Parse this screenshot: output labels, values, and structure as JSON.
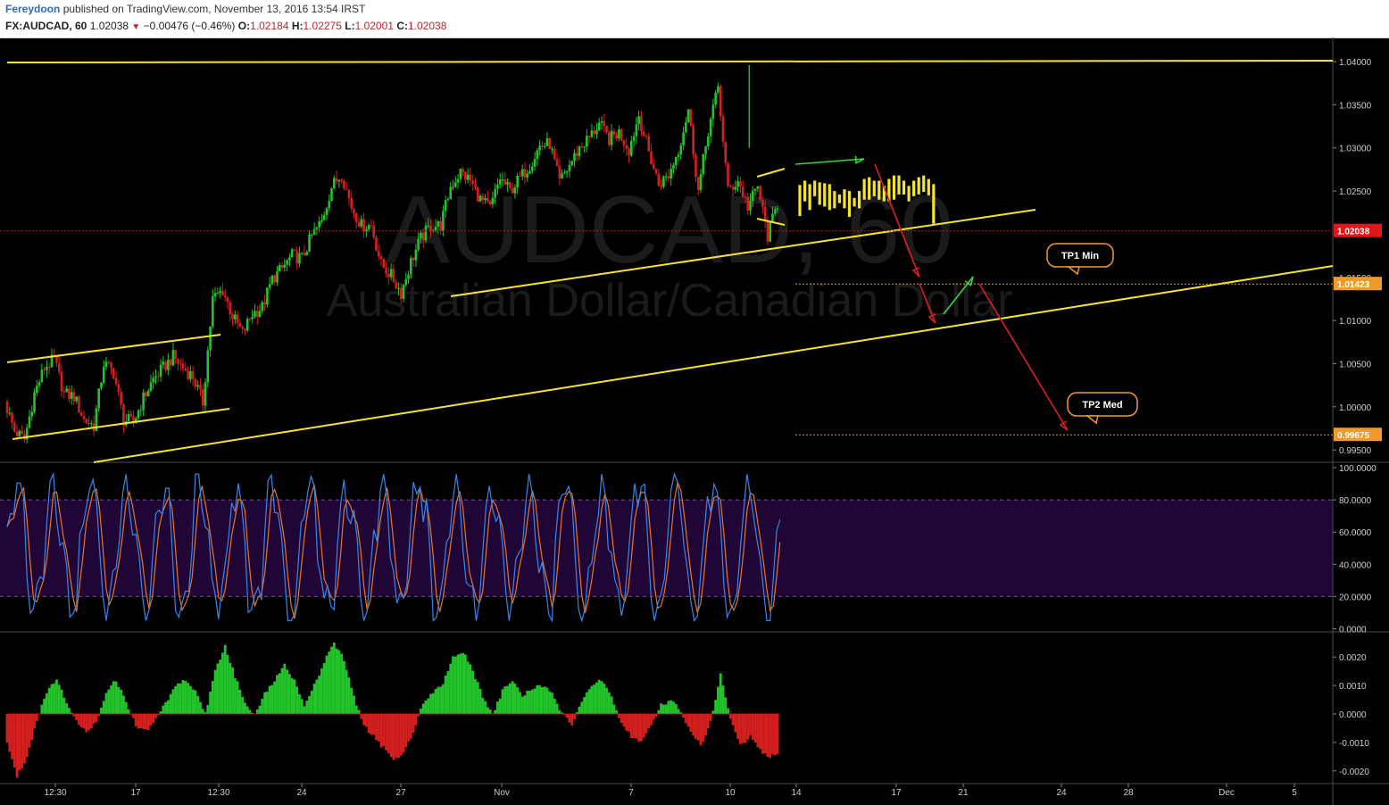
{
  "header": {
    "author": "Fereydoon",
    "published": "published on TradingView.com, November 13, 2016 13:54 IRST",
    "symbol": "FX:AUDCAD, 60",
    "last": "1.02038",
    "change": "−0.00476 (−0.46%)",
    "o_label": "O:",
    "o_value": "1.02184",
    "h_label": "H:",
    "h_value": "1.02275",
    "l_label": "L:",
    "l_value": "1.02001",
    "c_label": "C:",
    "c_value": "1.02038"
  },
  "colors": {
    "background": "#000000",
    "bull": "#22c42a",
    "bear": "#d41f1f",
    "trendline": "#f5e52a",
    "projection": "#f5e52a",
    "arrow_up": "#2fdc2f",
    "arrow_down": "#dd2020",
    "stoch_k": "#3a86e8",
    "stoch_d": "#e8742a",
    "stoch_band": "#1f0636",
    "label_orange": "#f09a2a",
    "price_red": "#e01818"
  },
  "watermark": {
    "symbol": "AUDCAD, 60",
    "name": "Australian Dollar/Canadian Dollar"
  },
  "chart_data": [
    {
      "type": "candlestick",
      "title": "FX:AUDCAD, 60",
      "x_ticks": [
        "12:30",
        "17",
        "12:30",
        "24",
        "27",
        "Nov",
        "7",
        "10",
        "14",
        "17",
        "21",
        "24",
        "28",
        "Dec",
        "5"
      ],
      "y_ticks": [
        "1.04000",
        "1.03500",
        "1.03000",
        "1.02500",
        "1.01500",
        "1.01000",
        "1.00500",
        "1.00000",
        "0.99500"
      ],
      "ylim": [
        0.9935,
        1.0416
      ],
      "close_path": [
        [
          0,
          1.0006
        ],
        [
          1,
          0.9972
        ],
        [
          2,
          0.9962
        ],
        [
          3,
          1.0015
        ],
        [
          4,
          1.0045
        ],
        [
          5,
          1.0055
        ],
        [
          6,
          1.0015
        ],
        [
          7,
          1.0012
        ],
        [
          8,
          0.9985
        ],
        [
          9,
          0.9978
        ],
        [
          10,
          1.005
        ],
        [
          11,
          1.004
        ],
        [
          12,
          0.9985
        ],
        [
          13,
          0.9982
        ],
        [
          14,
          1.001
        ],
        [
          15,
          1.0032
        ],
        [
          16,
          1.0045
        ],
        [
          17,
          1.0058
        ],
        [
          18,
          1.0045
        ],
        [
          19,
          1.0035
        ],
        [
          20,
          1.0005
        ],
        [
          21,
          1.0125
        ],
        [
          22,
          1.0135
        ],
        [
          23,
          1.0105
        ],
        [
          24,
          1.0085
        ],
        [
          25,
          1.0108
        ],
        [
          26,
          1.0115
        ],
        [
          27,
          1.0148
        ],
        [
          28,
          1.016
        ],
        [
          29,
          1.0175
        ],
        [
          30,
          1.0172
        ],
        [
          31,
          1.0198
        ],
        [
          32,
          1.0215
        ],
        [
          33,
          1.0255
        ],
        [
          34,
          1.027
        ],
        [
          35,
          1.0232
        ],
        [
          36,
          1.021
        ],
        [
          37,
          1.021
        ],
        [
          38,
          1.0165
        ],
        [
          39,
          1.0152
        ],
        [
          40,
          1.0132
        ],
        [
          41,
          1.0168
        ],
        [
          42,
          1.0195
        ],
        [
          43,
          1.021
        ],
        [
          44,
          1.021
        ],
        [
          45,
          1.0255
        ],
        [
          46,
          1.0272
        ],
        [
          47,
          1.0262
        ],
        [
          48,
          1.024
        ],
        [
          49,
          1.023
        ],
        [
          50,
          1.0265
        ],
        [
          51,
          1.025
        ],
        [
          52,
          1.0265
        ],
        [
          53,
          1.028
        ],
        [
          54,
          1.0302
        ],
        [
          55,
          1.0305
        ],
        [
          56,
          1.026
        ],
        [
          57,
          1.028
        ],
        [
          58,
          1.03
        ],
        [
          59,
          1.0312
        ],
        [
          60,
          1.0328
        ],
        [
          61,
          1.031
        ],
        [
          62,
          1.0318
        ],
        [
          63,
          1.0298
        ],
        [
          64,
          1.0338
        ],
        [
          65,
          1.0295
        ],
        [
          66,
          1.0258
        ],
        [
          67,
          1.0268
        ],
        [
          68,
          1.0298
        ],
        [
          69,
          1.0345
        ],
        [
          70,
          1.025
        ],
        [
          71,
          1.032
        ],
        [
          72,
          1.037
        ],
        [
          73,
          1.025
        ],
        [
          74,
          1.0262
        ],
        [
          75,
          1.0232
        ],
        [
          76,
          1.0255
        ],
        [
          77,
          1.0198
        ],
        [
          78,
          1.0236
        ]
      ],
      "last_price": 1.02038,
      "price_line_label": "1.02038",
      "levels": [
        {
          "value": 1.01423,
          "label": "1.01423",
          "note": "TP1 Min"
        },
        {
          "value": 0.99675,
          "label": "0.99675",
          "note": "TP2 Med"
        }
      ],
      "annotations": [
        "TP1 Min",
        "TP2 Med"
      ],
      "grid": false
    },
    {
      "type": "line",
      "title": "",
      "y_ticks": [
        "100.0000",
        "80.0000",
        "60.0000",
        "40.0000",
        "20.0000",
        "0.0000"
      ],
      "ylim": [
        0,
        100
      ],
      "band": [
        20,
        80
      ],
      "series": [
        {
          "values": []
        },
        {
          "values": []
        }
      ]
    },
    {
      "type": "bar",
      "title": "",
      "y_ticks": [
        "0.0020",
        "0.0010",
        "0.0000",
        "-0.0010",
        "-0.0020"
      ],
      "ylim": [
        -0.0023,
        0.0026
      ],
      "values": [
        [
          0,
          -0.001
        ],
        [
          1,
          -0.0022
        ],
        [
          2,
          -0.0015
        ],
        [
          3,
          -0.0002
        ],
        [
          4,
          0.0008
        ],
        [
          5,
          0.0012
        ],
        [
          6,
          0.0004
        ],
        [
          7,
          -0.0002
        ],
        [
          8,
          -0.0007
        ],
        [
          9,
          -0.0003
        ],
        [
          10,
          0.0008
        ],
        [
          11,
          0.0012
        ],
        [
          12,
          0.0004
        ],
        [
          13,
          -0.0004
        ],
        [
          14,
          -0.0006
        ],
        [
          15,
          -0.0002
        ],
        [
          16,
          0.0004
        ],
        [
          17,
          0.001
        ],
        [
          18,
          0.0012
        ],
        [
          19,
          0.0008
        ],
        [
          20,
          0.0
        ],
        [
          21,
          0.0015
        ],
        [
          22,
          0.0024
        ],
        [
          23,
          0.0013
        ],
        [
          24,
          0.0004
        ],
        [
          25,
          0.0
        ],
        [
          26,
          0.0007
        ],
        [
          27,
          0.0012
        ],
        [
          28,
          0.0017
        ],
        [
          29,
          0.0012
        ],
        [
          30,
          0.0003
        ],
        [
          31,
          0.001
        ],
        [
          32,
          0.0018
        ],
        [
          33,
          0.0025
        ],
        [
          34,
          0.0019
        ],
        [
          35,
          0.0006
        ],
        [
          36,
          -0.0004
        ],
        [
          37,
          -0.0008
        ],
        [
          38,
          -0.0012
        ],
        [
          39,
          -0.0016
        ],
        [
          40,
          -0.0014
        ],
        [
          41,
          -0.0006
        ],
        [
          42,
          0.0004
        ],
        [
          43,
          0.0008
        ],
        [
          44,
          0.0011
        ],
        [
          45,
          0.002
        ],
        [
          46,
          0.0022
        ],
        [
          47,
          0.0015
        ],
        [
          48,
          0.0006
        ],
        [
          49,
          0.0
        ],
        [
          50,
          0.0008
        ],
        [
          51,
          0.0012
        ],
        [
          52,
          0.0006
        ],
        [
          53,
          0.0009
        ],
        [
          54,
          0.001
        ],
        [
          55,
          0.0008
        ],
        [
          56,
          0.0
        ],
        [
          57,
          -0.0004
        ],
        [
          58,
          0.0004
        ],
        [
          59,
          0.001
        ],
        [
          60,
          0.0012
        ],
        [
          61,
          0.0006
        ],
        [
          62,
          -0.0003
        ],
        [
          63,
          -0.0008
        ],
        [
          64,
          -0.001
        ],
        [
          65,
          -0.0004
        ],
        [
          66,
          0.0003
        ],
        [
          67,
          0.0005
        ],
        [
          68,
          0.0001
        ],
        [
          69,
          -0.0007
        ],
        [
          70,
          -0.0011
        ],
        [
          71,
          -0.0003
        ],
        [
          72,
          0.0014
        ],
        [
          73,
          -0.0002
        ],
        [
          74,
          -0.0011
        ],
        [
          75,
          -0.0008
        ],
        [
          76,
          -0.0013
        ],
        [
          77,
          -0.0015
        ],
        [
          78,
          -0.0014
        ]
      ]
    }
  ]
}
